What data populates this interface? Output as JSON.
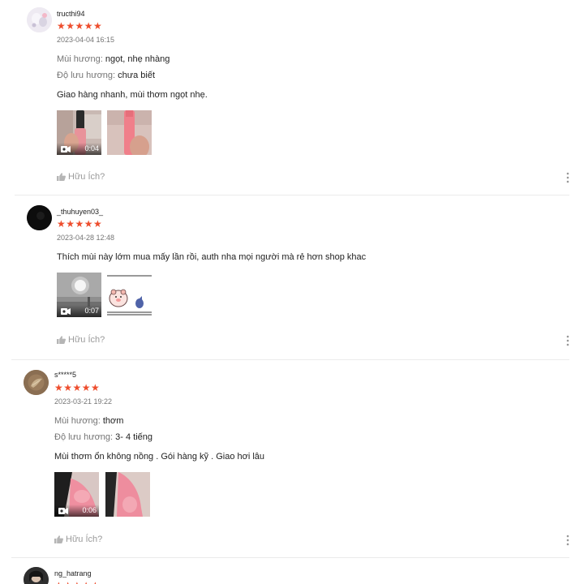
{
  "reviews": [
    {
      "username": "tructhi94",
      "stars": "★★★★★",
      "date": "2023-04-04 16:15",
      "scent_label": "Mùi hương:",
      "scent_value": "ngọt, nhẹ nhàng",
      "longevity_label": "Độ lưu hương:",
      "longevity_value": "chưa biết",
      "comment": "Giao hàng nhanh, mùi thơm ngọt nhẹ.",
      "video_duration": "0:04",
      "helpful_label": "Hữu Ích?"
    },
    {
      "username": "_thuhuyen03_",
      "stars": "★★★★★",
      "date": "2023-04-28 12:48",
      "comment": "Thích mùi này lớm mua mấy lần rồi, auth nha mọi người mà rẻ hơn shop khac",
      "video_duration": "0:07",
      "helpful_label": "Hữu Ích?"
    },
    {
      "username": "s*****5",
      "stars": "★★★★★",
      "date": "2023-03-21 19:22",
      "scent_label": "Mùi hương:",
      "scent_value": "thơm",
      "longevity_label": "Độ lưu hương:",
      "longevity_value": "3- 4 tiếng",
      "comment": "Mùi thơm ổn không nồng . Gói hàng kỹ . Giao hơi lâu",
      "video_duration": "0:06",
      "helpful_label": "Hữu Ích?"
    },
    {
      "username": "ng_hatrang",
      "stars": "★★★★★"
    }
  ],
  "colors": {
    "star": "#ee4d2d",
    "muted_text": "#757575",
    "divider": "#ebebeb"
  }
}
